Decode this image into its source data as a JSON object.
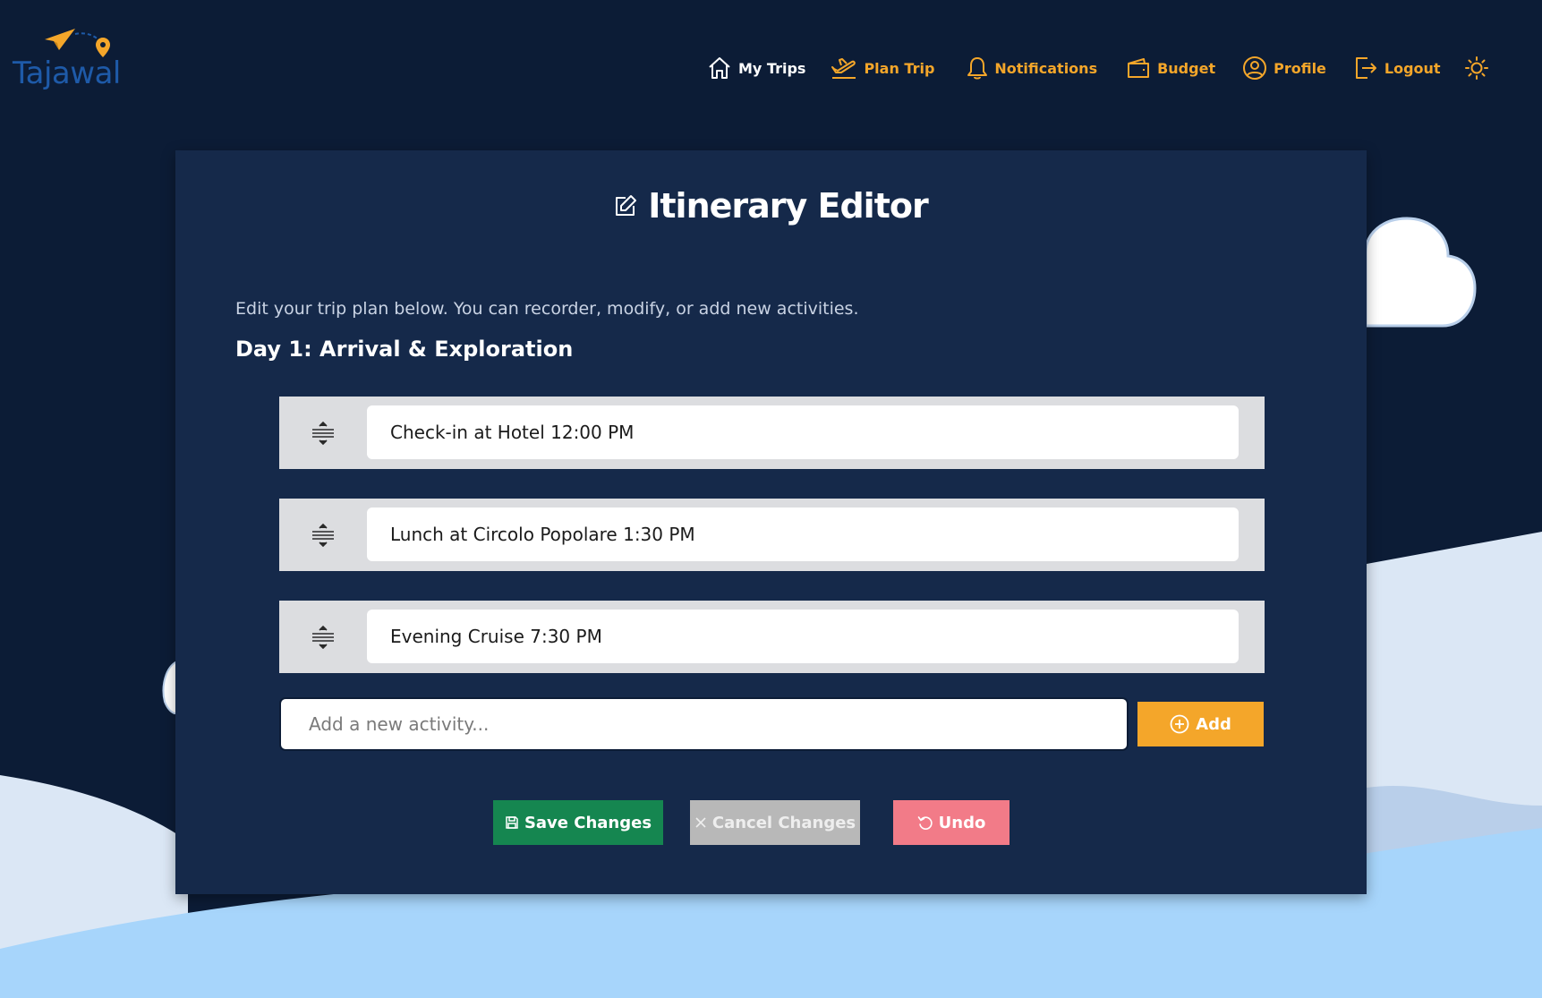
{
  "brand": {
    "name": "Tajawal"
  },
  "nav": {
    "my_trips": "My Trips",
    "plan_trip": "Plan Trip",
    "notifications": "Notifications",
    "budget": "Budget",
    "profile": "Profile",
    "logout": "Logout",
    "theme_icon": "sun-icon"
  },
  "editor": {
    "title": "Itinerary Editor",
    "intro": "Edit your trip plan below. You can recorder, modify, or add new activities.",
    "day_heading": "Day 1: Arrival & Exploration",
    "activities": [
      {
        "text": "Check-in at Hotel 12:00 PM"
      },
      {
        "text": "Lunch at Circolo Popolare 1:30 PM"
      },
      {
        "text": "Evening Cruise 7:30 PM"
      }
    ],
    "new_activity_placeholder": "Add a new activity...",
    "add_label": "Add"
  },
  "actions": {
    "save_label": "Save Changes",
    "cancel_label": "Cancel Changes",
    "undo_label": "Undo"
  },
  "colors": {
    "background": "#0c1c36",
    "card": "#15294a",
    "accent": "#f4a62a",
    "save": "#158650",
    "cancel": "#b8b8b8",
    "undo": "#f27b88",
    "brand": "#1e5aa8"
  }
}
